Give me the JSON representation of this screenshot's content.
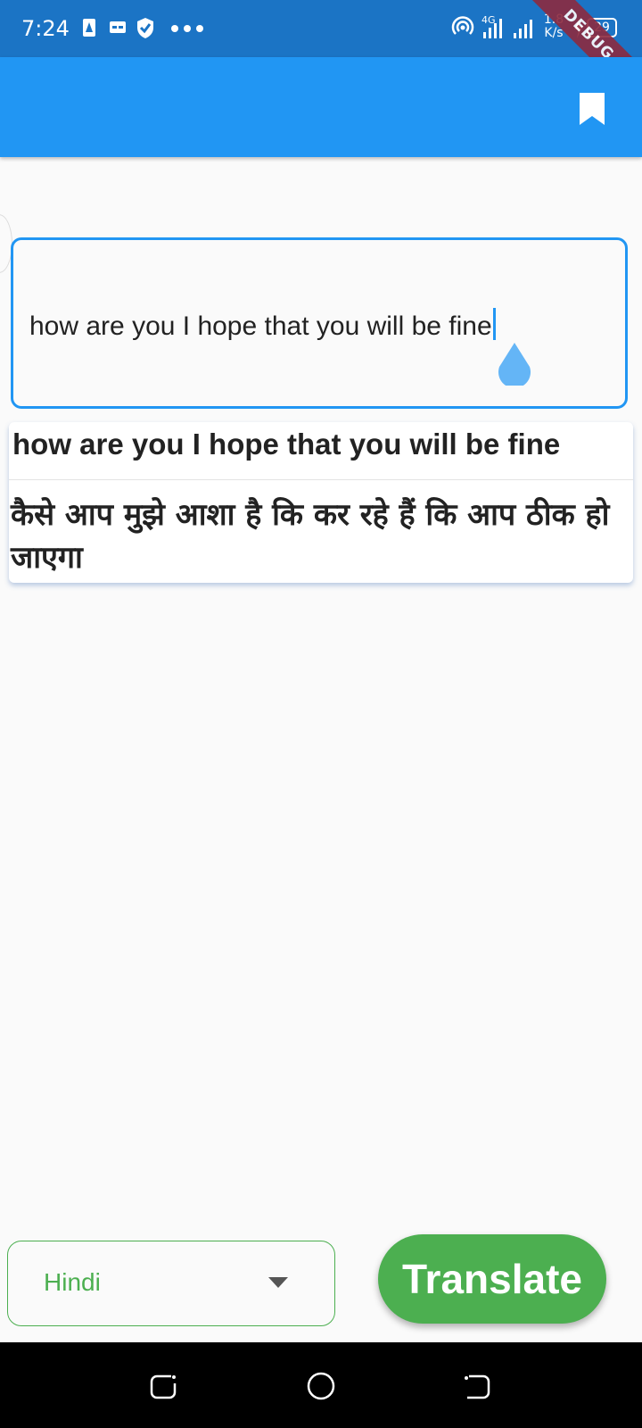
{
  "status_bar": {
    "time": "7:24",
    "network": "4G",
    "speed_value": "1.8",
    "speed_unit": "K/s",
    "battery": "29",
    "icons": [
      "notification-a-icon",
      "message-icon",
      "shield-icon",
      "more-dots-icon",
      "hotspot-icon",
      "signal-4g-icon",
      "signal-icon",
      "charging-icon",
      "battery-icon"
    ]
  },
  "debug_banner": "DEBUG",
  "app_bar": {
    "title": "",
    "action_icon": "bookmark-icon",
    "color": "#2196f3"
  },
  "input": {
    "value": "how are you I hope that you will be fine",
    "border_color": "#2196f3"
  },
  "result": {
    "source_text": "how are you I hope that you will be fine",
    "translated_text": "कैसे आप मुझे आशा है कि कर रहे हैं कि आप ठीक हो जाएगा"
  },
  "language_select": {
    "selected": "Hindi",
    "icon": "dropdown-arrow-icon",
    "color": "#4caf50"
  },
  "translate_button": {
    "label": "Translate",
    "color": "#4caf50"
  },
  "nav_bar": {
    "icons": [
      "recent-apps-icon",
      "home-icon",
      "back-icon"
    ]
  }
}
